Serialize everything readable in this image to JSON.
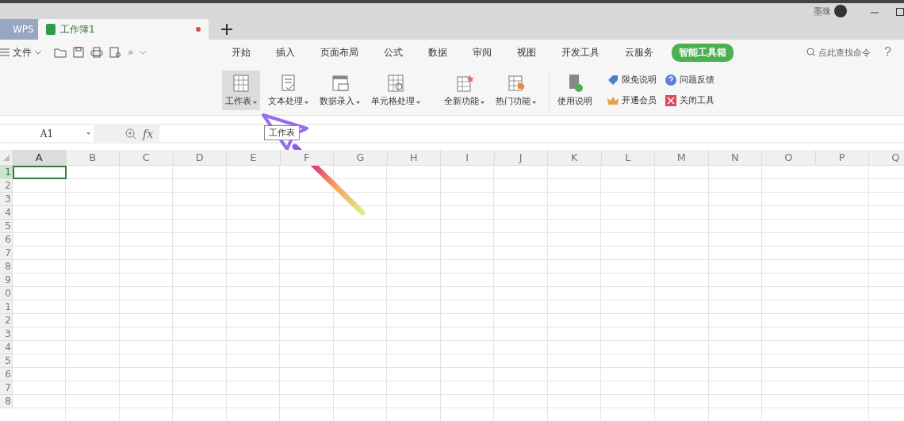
{
  "tabs": [
    {
      "label": "WPS",
      "kind": "app",
      "selected": false
    },
    {
      "label": "工作簿1",
      "kind": "doc",
      "selected": true
    }
  ],
  "user": {
    "name": "墨珠"
  },
  "menu": {
    "file": "文件",
    "more": "»",
    "tabs": [
      {
        "label": "开始",
        "selected": false
      },
      {
        "label": "插入",
        "selected": false
      },
      {
        "label": "页面布局",
        "selected": false
      },
      {
        "label": "公式",
        "selected": false
      },
      {
        "label": "数据",
        "selected": false
      },
      {
        "label": "审阅",
        "selected": false
      },
      {
        "label": "视图",
        "selected": false
      },
      {
        "label": "开发工具",
        "selected": false
      },
      {
        "label": "云服务",
        "selected": false
      },
      {
        "label": "智能工具箱",
        "selected": true
      }
    ],
    "search": {
      "placeholder": "点此查找命令"
    },
    "help": "?"
  },
  "ribbon": {
    "groups": [
      {
        "label": "工作表",
        "kind": "sheet",
        "selected": true
      },
      {
        "label": "文本处理",
        "kind": "text",
        "selected": false
      },
      {
        "label": "数据录入",
        "kind": "entry",
        "selected": false
      },
      {
        "label": "单元格处理",
        "kind": "cell",
        "selected": false
      },
      {
        "label": "全新功能",
        "kind": "new",
        "selected": false
      },
      {
        "label": "热门功能",
        "kind": "hot",
        "selected": false
      }
    ],
    "guide": "使用说明",
    "links": [
      {
        "label": "限免说明",
        "kind": "tag"
      },
      {
        "label": "问题反馈",
        "kind": "question"
      },
      {
        "label": "开通会员",
        "kind": "crown"
      },
      {
        "label": "关闭工具",
        "kind": "close"
      }
    ]
  },
  "formula_bar": {
    "name_box": "A1",
    "fx": "fx"
  },
  "tooltip": "工作表",
  "grid": {
    "columns": [
      {
        "label": "A",
        "selected": true
      },
      {
        "label": "B",
        "selected": false
      },
      {
        "label": "C",
        "selected": false
      },
      {
        "label": "D",
        "selected": false
      },
      {
        "label": "E",
        "selected": false
      },
      {
        "label": "F",
        "selected": false
      },
      {
        "label": "G",
        "selected": false
      },
      {
        "label": "H",
        "selected": false
      },
      {
        "label": "I",
        "selected": false
      },
      {
        "label": "J",
        "selected": false
      },
      {
        "label": "K",
        "selected": false
      },
      {
        "label": "L",
        "selected": false
      },
      {
        "label": "M",
        "selected": false
      },
      {
        "label": "N",
        "selected": false
      },
      {
        "label": "O",
        "selected": false
      },
      {
        "label": "P",
        "selected": false
      },
      {
        "label": "Q",
        "selected": false
      }
    ],
    "rows": [
      {
        "label": "1",
        "selected": true
      },
      {
        "label": "2",
        "selected": false
      },
      {
        "label": "3",
        "selected": false
      },
      {
        "label": "4",
        "selected": false
      },
      {
        "label": "5",
        "selected": false
      },
      {
        "label": "6",
        "selected": false
      },
      {
        "label": "7",
        "selected": false
      },
      {
        "label": "8",
        "selected": false
      },
      {
        "label": "9",
        "selected": false
      },
      {
        "label": "0",
        "selected": false
      },
      {
        "label": "1",
        "selected": false
      },
      {
        "label": "2",
        "selected": false
      },
      {
        "label": "3",
        "selected": false
      },
      {
        "label": "4",
        "selected": false
      },
      {
        "label": "5",
        "selected": false
      },
      {
        "label": "6",
        "selected": false
      },
      {
        "label": "7",
        "selected": false
      },
      {
        "label": "8",
        "selected": false
      }
    ]
  }
}
